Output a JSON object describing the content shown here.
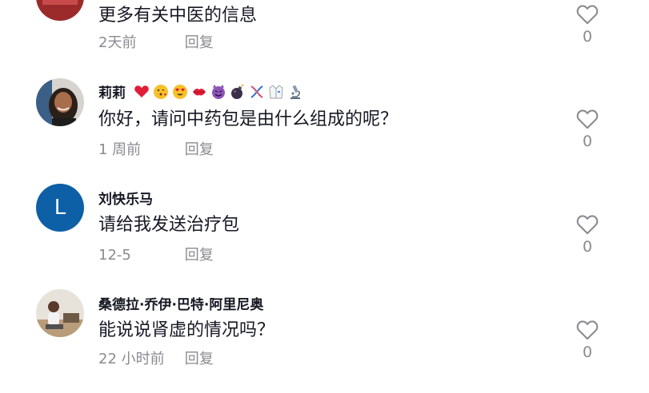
{
  "comments": [
    {
      "author": "",
      "text": "更多有关中医的信息",
      "time": "2天前",
      "reply_label": "回复",
      "likes": "0",
      "avatar_type": "photo-red"
    },
    {
      "author": "莉莉",
      "emojis": [
        "red-heart-icon",
        "face-blowing-kiss-icon",
        "heart-eyes-icon",
        "kiss-mark-icon",
        "smiling-devil-icon",
        "bomb-icon",
        "dna-icon",
        "lab-coat-icon",
        "microscope-icon"
      ],
      "text": "你好，请问中药包是由什么组成的呢？",
      "time": "1 周前",
      "reply_label": "回复",
      "likes": "0",
      "avatar_type": "photo-woman"
    },
    {
      "author": "刘快乐马",
      "avatar_letter": "L",
      "text": "请给我发送治疗包",
      "time": "12-5",
      "reply_label": "回复",
      "likes": "0",
      "avatar_type": "letter"
    },
    {
      "author": "桑德拉·乔伊·巴特·阿里尼奥",
      "text": "能说说肾虚的情况吗？",
      "time": "22 小时前",
      "reply_label": "回复",
      "likes": "0",
      "avatar_type": "photo-indoor"
    }
  ],
  "colors": {
    "avatar_letter_bg": "#0d5fa6",
    "meta_text": "#8a8b91",
    "primary_text": "#161823"
  }
}
